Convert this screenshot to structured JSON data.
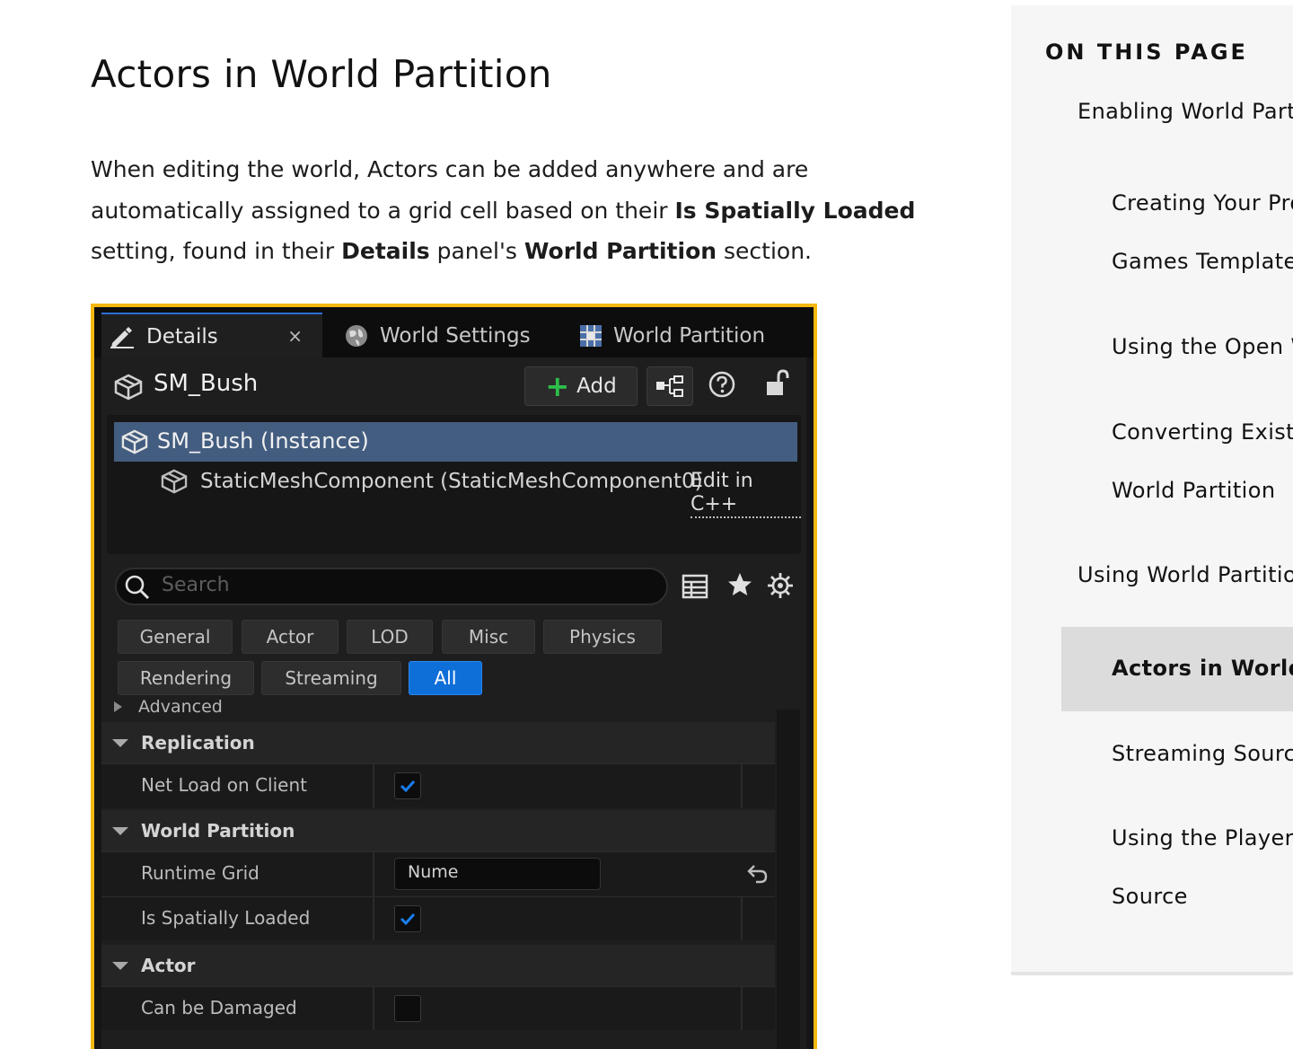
{
  "article": {
    "title": "Actors in World Partition",
    "para_1": "When editing the world, Actors can be added anywhere and are automatically assigned to a grid cell based on their ",
    "bold_1": "Is Spatially Loaded",
    "para_2": " setting, found in their ",
    "bold_2": "Details",
    "para_3": " panel's ",
    "bold_3": "World Partition",
    "para_4": " section."
  },
  "editor": {
    "tabs": [
      {
        "label": "Details",
        "icon": "pencil-icon"
      },
      {
        "label": "World Settings",
        "icon": "globe-icon"
      },
      {
        "label": "World Partition",
        "icon": "grid-icon"
      }
    ],
    "close_glyph": "×",
    "actor_name": "SM_Bush",
    "add_label": "Add",
    "tree": {
      "selected": "SM_Bush (Instance)",
      "child": "StaticMeshComponent (StaticMeshComponent0)",
      "edit_link": "Edit in C++"
    },
    "search_placeholder": "Search",
    "filters": [
      "General",
      "Actor",
      "LOD",
      "Misc",
      "Physics",
      "Rendering",
      "Streaming",
      "All"
    ],
    "active_filter": "All",
    "advanced_label": "Advanced",
    "categories": {
      "replication": "Replication",
      "world_partition": "World Partition",
      "actor": "Actor"
    },
    "props": {
      "net_load": {
        "label": "Net Load on Client",
        "checked": true
      },
      "runtime_grid": {
        "label": "Runtime Grid",
        "value": "Nume"
      },
      "spatially_loaded": {
        "label": "Is Spatially Loaded",
        "checked": true
      },
      "can_be_damaged": {
        "label": "Can be Damaged",
        "checked": false
      }
    },
    "colors": {
      "accent": "#0f6fd9",
      "frame": "#f4b80e",
      "selection": "#435d80",
      "add_plus": "#2cc04a"
    }
  },
  "toc": {
    "title": "ON THIS PAGE",
    "items": [
      "Enabling World Partiti",
      "Creating Your Pro",
      "Games Template",
      "Using the Open W",
      "Converting Existi",
      "World Partition",
      "Using World Partition",
      "Actors in World Pa",
      "Streaming Source",
      "Using the Player a",
      "Source"
    ]
  }
}
